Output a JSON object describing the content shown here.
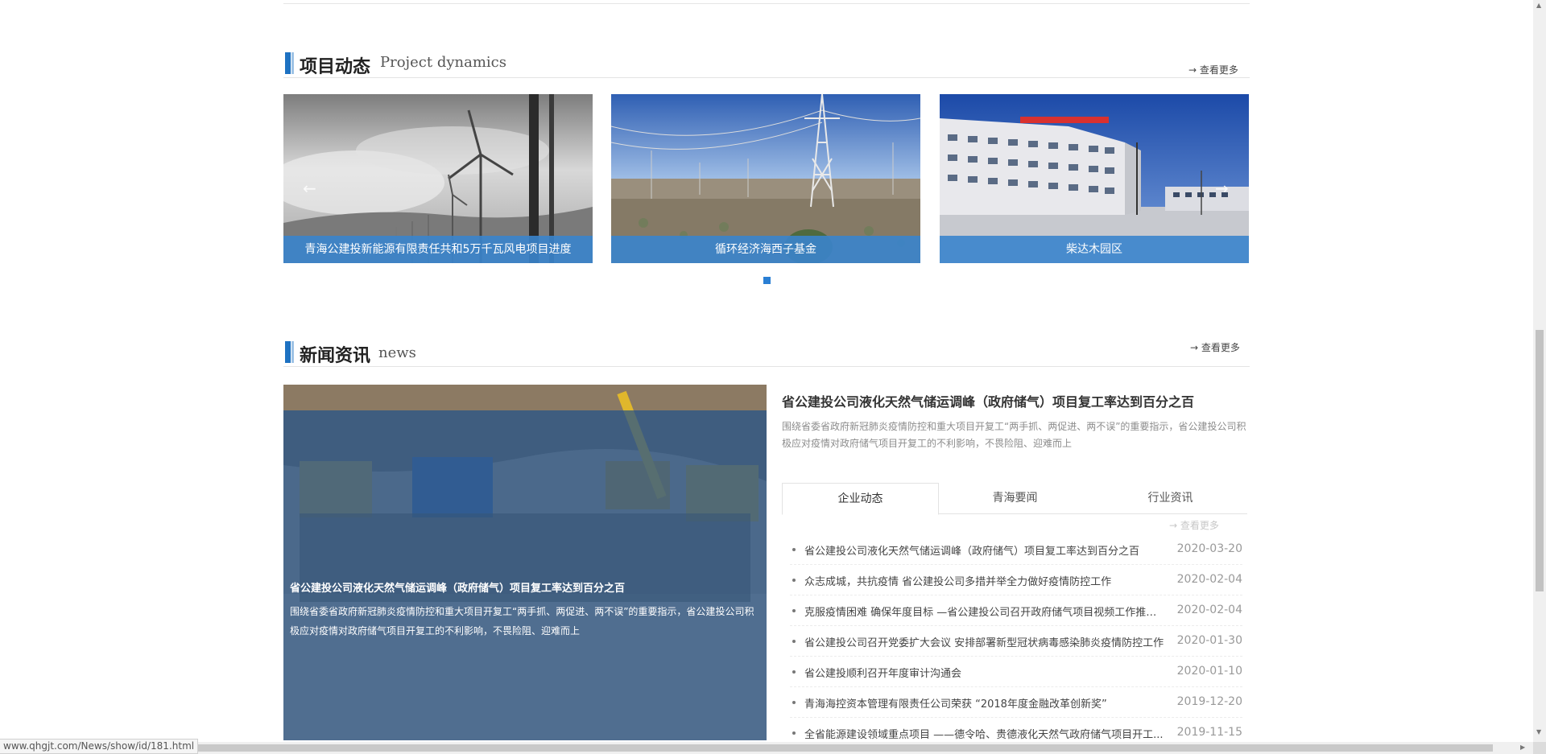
{
  "project": {
    "title_cn": "项目动态",
    "title_en": "Project dynamics",
    "more": "→ 查看更多",
    "cards": [
      {
        "caption": "青海公建投新能源有限责任共和5万千瓦风电项目进度"
      },
      {
        "caption": "循环经济海西子基金"
      },
      {
        "caption": "柴达木园区"
      }
    ],
    "prev_arrow": "←",
    "next_arrow": "→"
  },
  "news": {
    "title_cn": "新闻资讯",
    "title_en": "news",
    "more": "→ 查看更多",
    "feature": {
      "title": "省公建投公司液化天然气储运调峰（政府储气）项目复工率达到百分之百",
      "summary": "围绕省委省政府新冠肺炎疫情防控和重大项目开复工“两手抓、两促进、两不误”的重要指示，省公建投公司积极应对疫情对政府储气项目开复工的不利影响，不畏险阻、迎难而上"
    },
    "tabs": [
      "企业动态",
      "青海要闻",
      "行业资讯"
    ],
    "active_tab": 0,
    "list_more": "→ 查看更多",
    "items": [
      {
        "title": "省公建投公司液化天然气储运调峰（政府储气）项目复工率达到百分之百",
        "date": "2020-03-20"
      },
      {
        "title": "众志成城，共抗疫情 省公建投公司多措并举全力做好疫情防控工作",
        "date": "2020-02-04"
      },
      {
        "title": "克服疫情困难 确保年度目标 —省公建投公司召开政府储气项目视频工作推进...",
        "date": "2020-02-04"
      },
      {
        "title": "省公建投公司召开党委扩大会议 安排部署新型冠状病毒感染肺炎疫情防控工作",
        "date": "2020-01-30"
      },
      {
        "title": "省公建投顺利召开年度审计沟通会",
        "date": "2020-01-10"
      },
      {
        "title": "青海海控资本管理有限责任公司荣获 “2018年度金融改革创新奖”",
        "date": "2019-12-20"
      },
      {
        "title": "全省能源建设领域重点项目 ——德令哈、贵德液化天然气政府储气项目开工...",
        "date": "2019-11-15"
      }
    ]
  },
  "status_url": "www.qhgjt.com/News/show/id/181.html",
  "colors": {
    "accent": "#1e72c2",
    "caption_bg": "#3a84cc",
    "overlay": "#21528a"
  }
}
